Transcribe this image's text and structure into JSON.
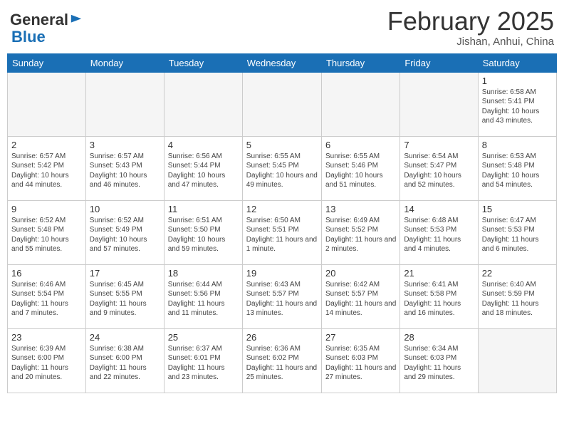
{
  "header": {
    "logo_general": "General",
    "logo_blue": "Blue",
    "month_title": "February 2025",
    "location": "Jishan, Anhui, China"
  },
  "weekdays": [
    "Sunday",
    "Monday",
    "Tuesday",
    "Wednesday",
    "Thursday",
    "Friday",
    "Saturday"
  ],
  "weeks": [
    [
      {
        "day": "",
        "info": ""
      },
      {
        "day": "",
        "info": ""
      },
      {
        "day": "",
        "info": ""
      },
      {
        "day": "",
        "info": ""
      },
      {
        "day": "",
        "info": ""
      },
      {
        "day": "",
        "info": ""
      },
      {
        "day": "1",
        "info": "Sunrise: 6:58 AM\nSunset: 5:41 PM\nDaylight: 10 hours and 43 minutes."
      }
    ],
    [
      {
        "day": "2",
        "info": "Sunrise: 6:57 AM\nSunset: 5:42 PM\nDaylight: 10 hours and 44 minutes."
      },
      {
        "day": "3",
        "info": "Sunrise: 6:57 AM\nSunset: 5:43 PM\nDaylight: 10 hours and 46 minutes."
      },
      {
        "day": "4",
        "info": "Sunrise: 6:56 AM\nSunset: 5:44 PM\nDaylight: 10 hours and 47 minutes."
      },
      {
        "day": "5",
        "info": "Sunrise: 6:55 AM\nSunset: 5:45 PM\nDaylight: 10 hours and 49 minutes."
      },
      {
        "day": "6",
        "info": "Sunrise: 6:55 AM\nSunset: 5:46 PM\nDaylight: 10 hours and 51 minutes."
      },
      {
        "day": "7",
        "info": "Sunrise: 6:54 AM\nSunset: 5:47 PM\nDaylight: 10 hours and 52 minutes."
      },
      {
        "day": "8",
        "info": "Sunrise: 6:53 AM\nSunset: 5:48 PM\nDaylight: 10 hours and 54 minutes."
      }
    ],
    [
      {
        "day": "9",
        "info": "Sunrise: 6:52 AM\nSunset: 5:48 PM\nDaylight: 10 hours and 55 minutes."
      },
      {
        "day": "10",
        "info": "Sunrise: 6:52 AM\nSunset: 5:49 PM\nDaylight: 10 hours and 57 minutes."
      },
      {
        "day": "11",
        "info": "Sunrise: 6:51 AM\nSunset: 5:50 PM\nDaylight: 10 hours and 59 minutes."
      },
      {
        "day": "12",
        "info": "Sunrise: 6:50 AM\nSunset: 5:51 PM\nDaylight: 11 hours and 1 minute."
      },
      {
        "day": "13",
        "info": "Sunrise: 6:49 AM\nSunset: 5:52 PM\nDaylight: 11 hours and 2 minutes."
      },
      {
        "day": "14",
        "info": "Sunrise: 6:48 AM\nSunset: 5:53 PM\nDaylight: 11 hours and 4 minutes."
      },
      {
        "day": "15",
        "info": "Sunrise: 6:47 AM\nSunset: 5:53 PM\nDaylight: 11 hours and 6 minutes."
      }
    ],
    [
      {
        "day": "16",
        "info": "Sunrise: 6:46 AM\nSunset: 5:54 PM\nDaylight: 11 hours and 7 minutes."
      },
      {
        "day": "17",
        "info": "Sunrise: 6:45 AM\nSunset: 5:55 PM\nDaylight: 11 hours and 9 minutes."
      },
      {
        "day": "18",
        "info": "Sunrise: 6:44 AM\nSunset: 5:56 PM\nDaylight: 11 hours and 11 minutes."
      },
      {
        "day": "19",
        "info": "Sunrise: 6:43 AM\nSunset: 5:57 PM\nDaylight: 11 hours and 13 minutes."
      },
      {
        "day": "20",
        "info": "Sunrise: 6:42 AM\nSunset: 5:57 PM\nDaylight: 11 hours and 14 minutes."
      },
      {
        "day": "21",
        "info": "Sunrise: 6:41 AM\nSunset: 5:58 PM\nDaylight: 11 hours and 16 minutes."
      },
      {
        "day": "22",
        "info": "Sunrise: 6:40 AM\nSunset: 5:59 PM\nDaylight: 11 hours and 18 minutes."
      }
    ],
    [
      {
        "day": "23",
        "info": "Sunrise: 6:39 AM\nSunset: 6:00 PM\nDaylight: 11 hours and 20 minutes."
      },
      {
        "day": "24",
        "info": "Sunrise: 6:38 AM\nSunset: 6:00 PM\nDaylight: 11 hours and 22 minutes."
      },
      {
        "day": "25",
        "info": "Sunrise: 6:37 AM\nSunset: 6:01 PM\nDaylight: 11 hours and 23 minutes."
      },
      {
        "day": "26",
        "info": "Sunrise: 6:36 AM\nSunset: 6:02 PM\nDaylight: 11 hours and 25 minutes."
      },
      {
        "day": "27",
        "info": "Sunrise: 6:35 AM\nSunset: 6:03 PM\nDaylight: 11 hours and 27 minutes."
      },
      {
        "day": "28",
        "info": "Sunrise: 6:34 AM\nSunset: 6:03 PM\nDaylight: 11 hours and 29 minutes."
      },
      {
        "day": "",
        "info": ""
      }
    ]
  ]
}
